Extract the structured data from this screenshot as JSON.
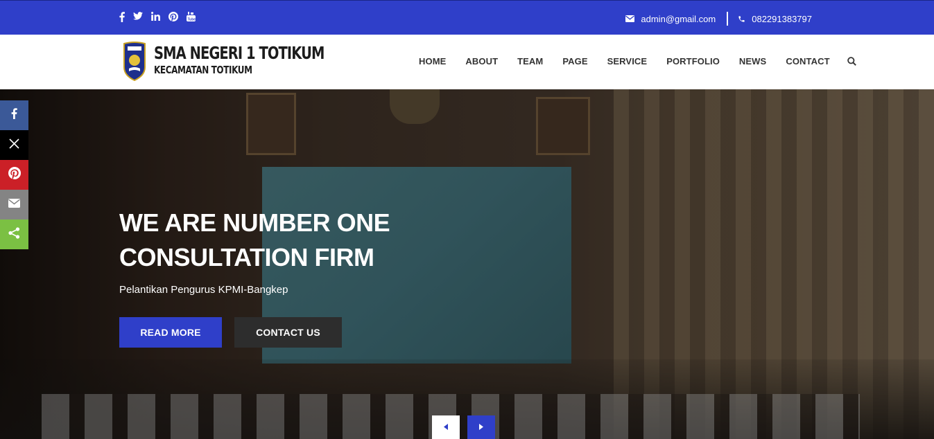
{
  "topbar": {
    "social_icons": [
      "facebook-icon",
      "twitter-icon",
      "linkedin-icon",
      "pinterest-icon",
      "youtube-icon"
    ],
    "email": "admin@gmail.com",
    "phone": "082291383797"
  },
  "header": {
    "logo_line1": "SMA NEGERI 1 TOTIKUM",
    "logo_line2": "KECAMATAN TOTIKUM",
    "nav": [
      "HOME",
      "ABOUT",
      "TEAM",
      "PAGE",
      "SERVICE",
      "PORTFOLIO",
      "NEWS",
      "CONTACT"
    ]
  },
  "hero": {
    "title_line1": "WE ARE NUMBER ONE",
    "title_line2": "CONSULTATION FIRM",
    "subtitle": "Pelantikan Pengurus KPMI-Bangkep",
    "btn_read": "READ MORE",
    "btn_contact": "CONTACT US"
  },
  "share_sidebar": [
    "facebook-icon",
    "x-icon",
    "pinterest-icon",
    "email-icon",
    "share-icon"
  ],
  "colors": {
    "primary": "#2f3fc9",
    "dark_button": "#2d2d2d",
    "facebook": "#3b5998",
    "x": "#000000",
    "pinterest": "#cb2027",
    "email": "#848484",
    "share": "#7bc043"
  }
}
